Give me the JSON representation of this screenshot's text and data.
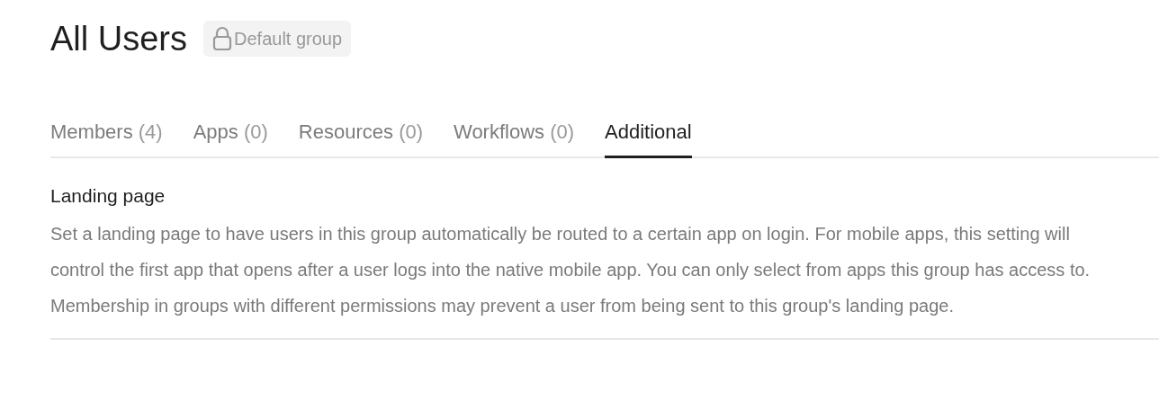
{
  "header": {
    "title": "All Users",
    "badge": "Default group"
  },
  "tabs": [
    {
      "label": "Members",
      "count": "(4)",
      "selected": false
    },
    {
      "label": "Apps",
      "count": "(0)",
      "selected": false
    },
    {
      "label": "Resources",
      "count": "(0)",
      "selected": false
    },
    {
      "label": "Workflows",
      "count": "(0)",
      "selected": false
    },
    {
      "label": "Additional",
      "selected": true
    }
  ],
  "section": {
    "heading": "Landing page",
    "description": "Set a landing page to have users in this group automatically be routed to a certain app on login. For mobile apps, this setting will control the first app that opens after a user logs into the native mobile app. You can only select from apps this group has access to. Membership in groups with different permissions may prevent a user from being sent to this group's landing page."
  }
}
